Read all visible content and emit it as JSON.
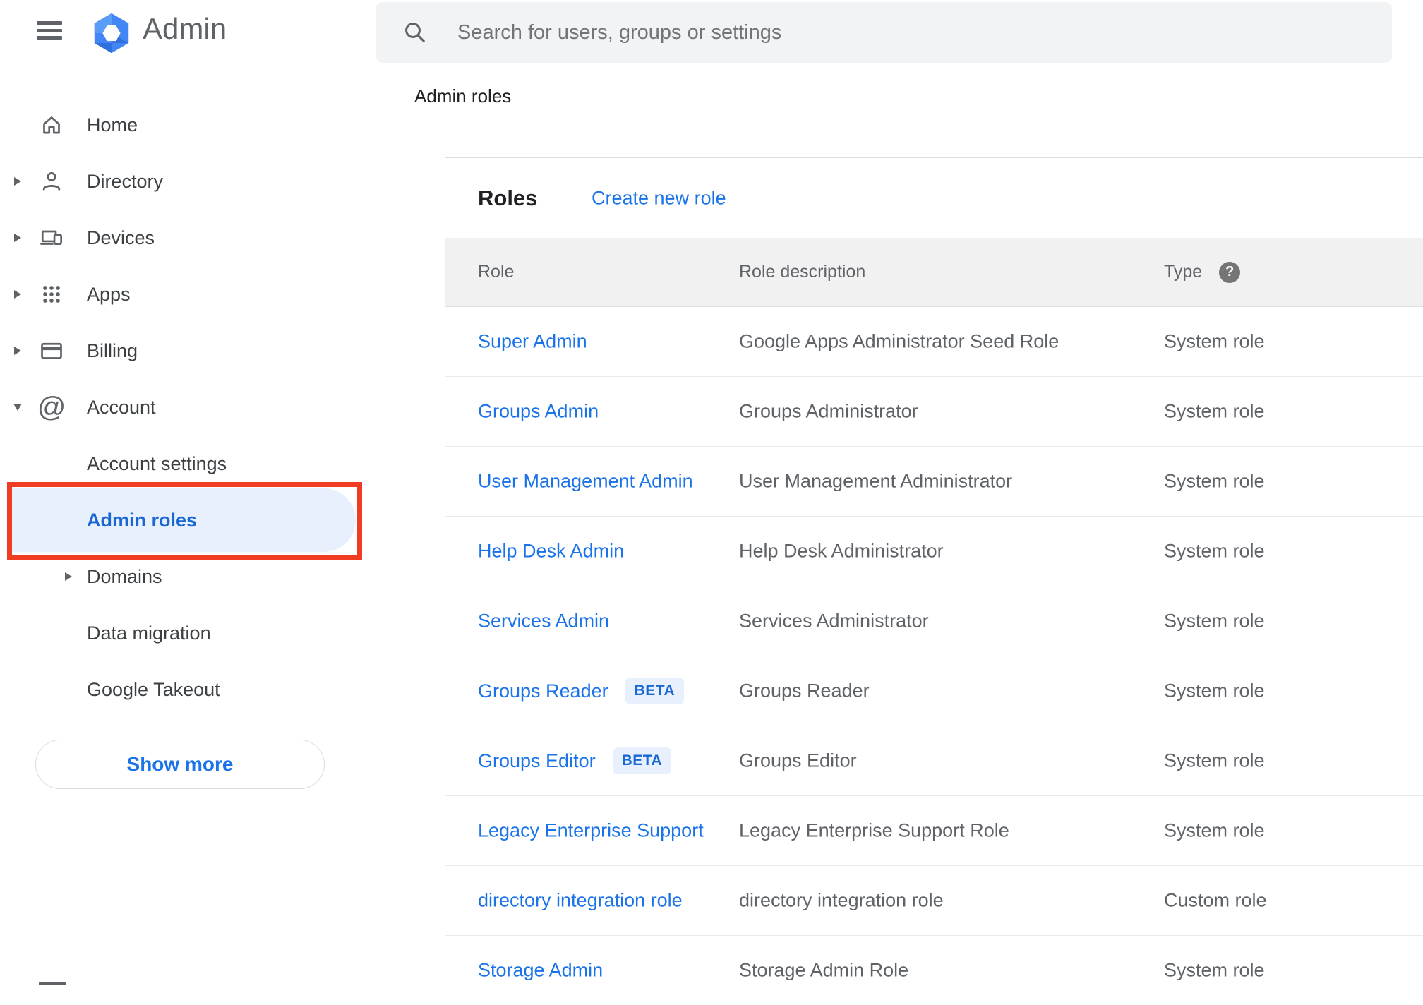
{
  "app": {
    "title": "Admin"
  },
  "search": {
    "placeholder": "Search for users, groups or settings"
  },
  "breadcrumb": "Admin roles",
  "sidebar": {
    "items": [
      {
        "label": "Home",
        "icon": "home",
        "caret": "none",
        "level": 0,
        "selected": false
      },
      {
        "label": "Directory",
        "icon": "person",
        "caret": "right",
        "level": 0,
        "selected": false
      },
      {
        "label": "Devices",
        "icon": "devices",
        "caret": "right",
        "level": 0,
        "selected": false
      },
      {
        "label": "Apps",
        "icon": "apps",
        "caret": "right",
        "level": 0,
        "selected": false
      },
      {
        "label": "Billing",
        "icon": "card",
        "caret": "right",
        "level": 0,
        "selected": false
      },
      {
        "label": "Account",
        "icon": "at",
        "caret": "down",
        "level": 0,
        "selected": false
      },
      {
        "label": "Account settings",
        "icon": "",
        "caret": "none",
        "level": 1,
        "selected": false
      },
      {
        "label": "Admin roles",
        "icon": "",
        "caret": "none",
        "level": 1,
        "selected": true
      },
      {
        "label": "Domains",
        "icon": "",
        "caret": "right",
        "level": 1,
        "selected": false
      },
      {
        "label": "Data migration",
        "icon": "",
        "caret": "none",
        "level": 1,
        "selected": false
      },
      {
        "label": "Google Takeout",
        "icon": "",
        "caret": "none",
        "level": 1,
        "selected": false
      }
    ],
    "show_more_label": "Show more"
  },
  "roles_card": {
    "title": "Roles",
    "create_link": "Create new role",
    "columns": [
      "Role",
      "Role description",
      "Type"
    ],
    "beta_label": "BETA",
    "rows": [
      {
        "role": "Super Admin",
        "beta": false,
        "description": "Google Apps Administrator Seed Role",
        "type": "System role"
      },
      {
        "role": "Groups Admin",
        "beta": false,
        "description": "Groups Administrator",
        "type": "System role"
      },
      {
        "role": "User Management Admin",
        "beta": false,
        "description": "User Management Administrator",
        "type": "System role"
      },
      {
        "role": "Help Desk Admin",
        "beta": false,
        "description": "Help Desk Administrator",
        "type": "System role"
      },
      {
        "role": "Services Admin",
        "beta": false,
        "description": "Services Administrator",
        "type": "System role"
      },
      {
        "role": "Groups Reader",
        "beta": true,
        "description": "Groups Reader",
        "type": "System role"
      },
      {
        "role": "Groups Editor",
        "beta": true,
        "description": "Groups Editor",
        "type": "System role"
      },
      {
        "role": "Legacy Enterprise Support",
        "beta": false,
        "description": "Legacy Enterprise Support Role",
        "type": "System role"
      },
      {
        "role": "directory integration role",
        "beta": false,
        "description": "directory integration role",
        "type": "Custom role"
      },
      {
        "role": "Storage Admin",
        "beta": false,
        "description": "Storage Admin Role",
        "type": "System role"
      }
    ]
  },
  "colors": {
    "link_blue": "#1a73e8",
    "selected_blue_text": "#1967d2",
    "selected_pill_bg": "#e8f0fe",
    "annotation_red": "#f03c22",
    "sidebar_text": "#3c4043",
    "muted_text": "#5f6368",
    "search_bg": "#f2f3f4",
    "table_header_bg": "#f1f1f2",
    "divider": "#dadce0"
  }
}
